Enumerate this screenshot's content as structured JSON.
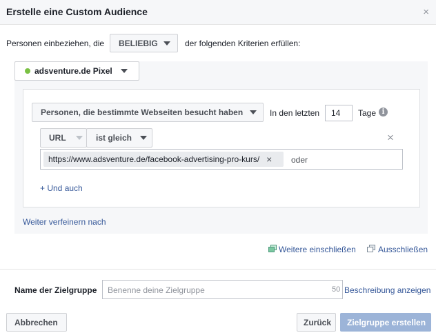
{
  "dialog": {
    "title": "Erstelle eine Custom Audience",
    "close_glyph": "×"
  },
  "criteria": {
    "prefix": "Personen einbeziehen, die",
    "match_select": "BELIEBIG",
    "suffix": "der folgenden Kriterien erfüllen:"
  },
  "pixel": {
    "label": "adsventure.de Pixel",
    "status_color": "#7ac143"
  },
  "rule": {
    "type_select": "Personen, die bestimmte Webseiten besucht haben",
    "days_prefix": "In den letzten",
    "days_value": "14",
    "days_suffix": "Tage",
    "info_glyph": "i",
    "filter_field": "URL",
    "filter_operator": "ist gleich",
    "url_token": "https://www.adsventure.de/facebook-advertising-pro-kurs/",
    "token_remove_glyph": "×",
    "or_placeholder": "oder",
    "add_and": "+ Und auch",
    "remove_glyph": "×"
  },
  "refine_link": "Weiter verfeinern nach",
  "include_more": "Weitere einschließen",
  "exclude": "Ausschließen",
  "audience_name": {
    "label": "Name der Zielgruppe",
    "placeholder": "Benenne deine Zielgruppe",
    "char_count": "50",
    "desc_link": "Beschreibung anzeigen"
  },
  "footer": {
    "cancel": "Abbrechen",
    "back": "Zurück",
    "create": "Zielgruppe erstellen"
  },
  "colors": {
    "link": "#365899",
    "primary_disabled": "#9cb4d8",
    "header_bg": "#f6f7f9",
    "panel_bg": "#f6f7f9"
  }
}
